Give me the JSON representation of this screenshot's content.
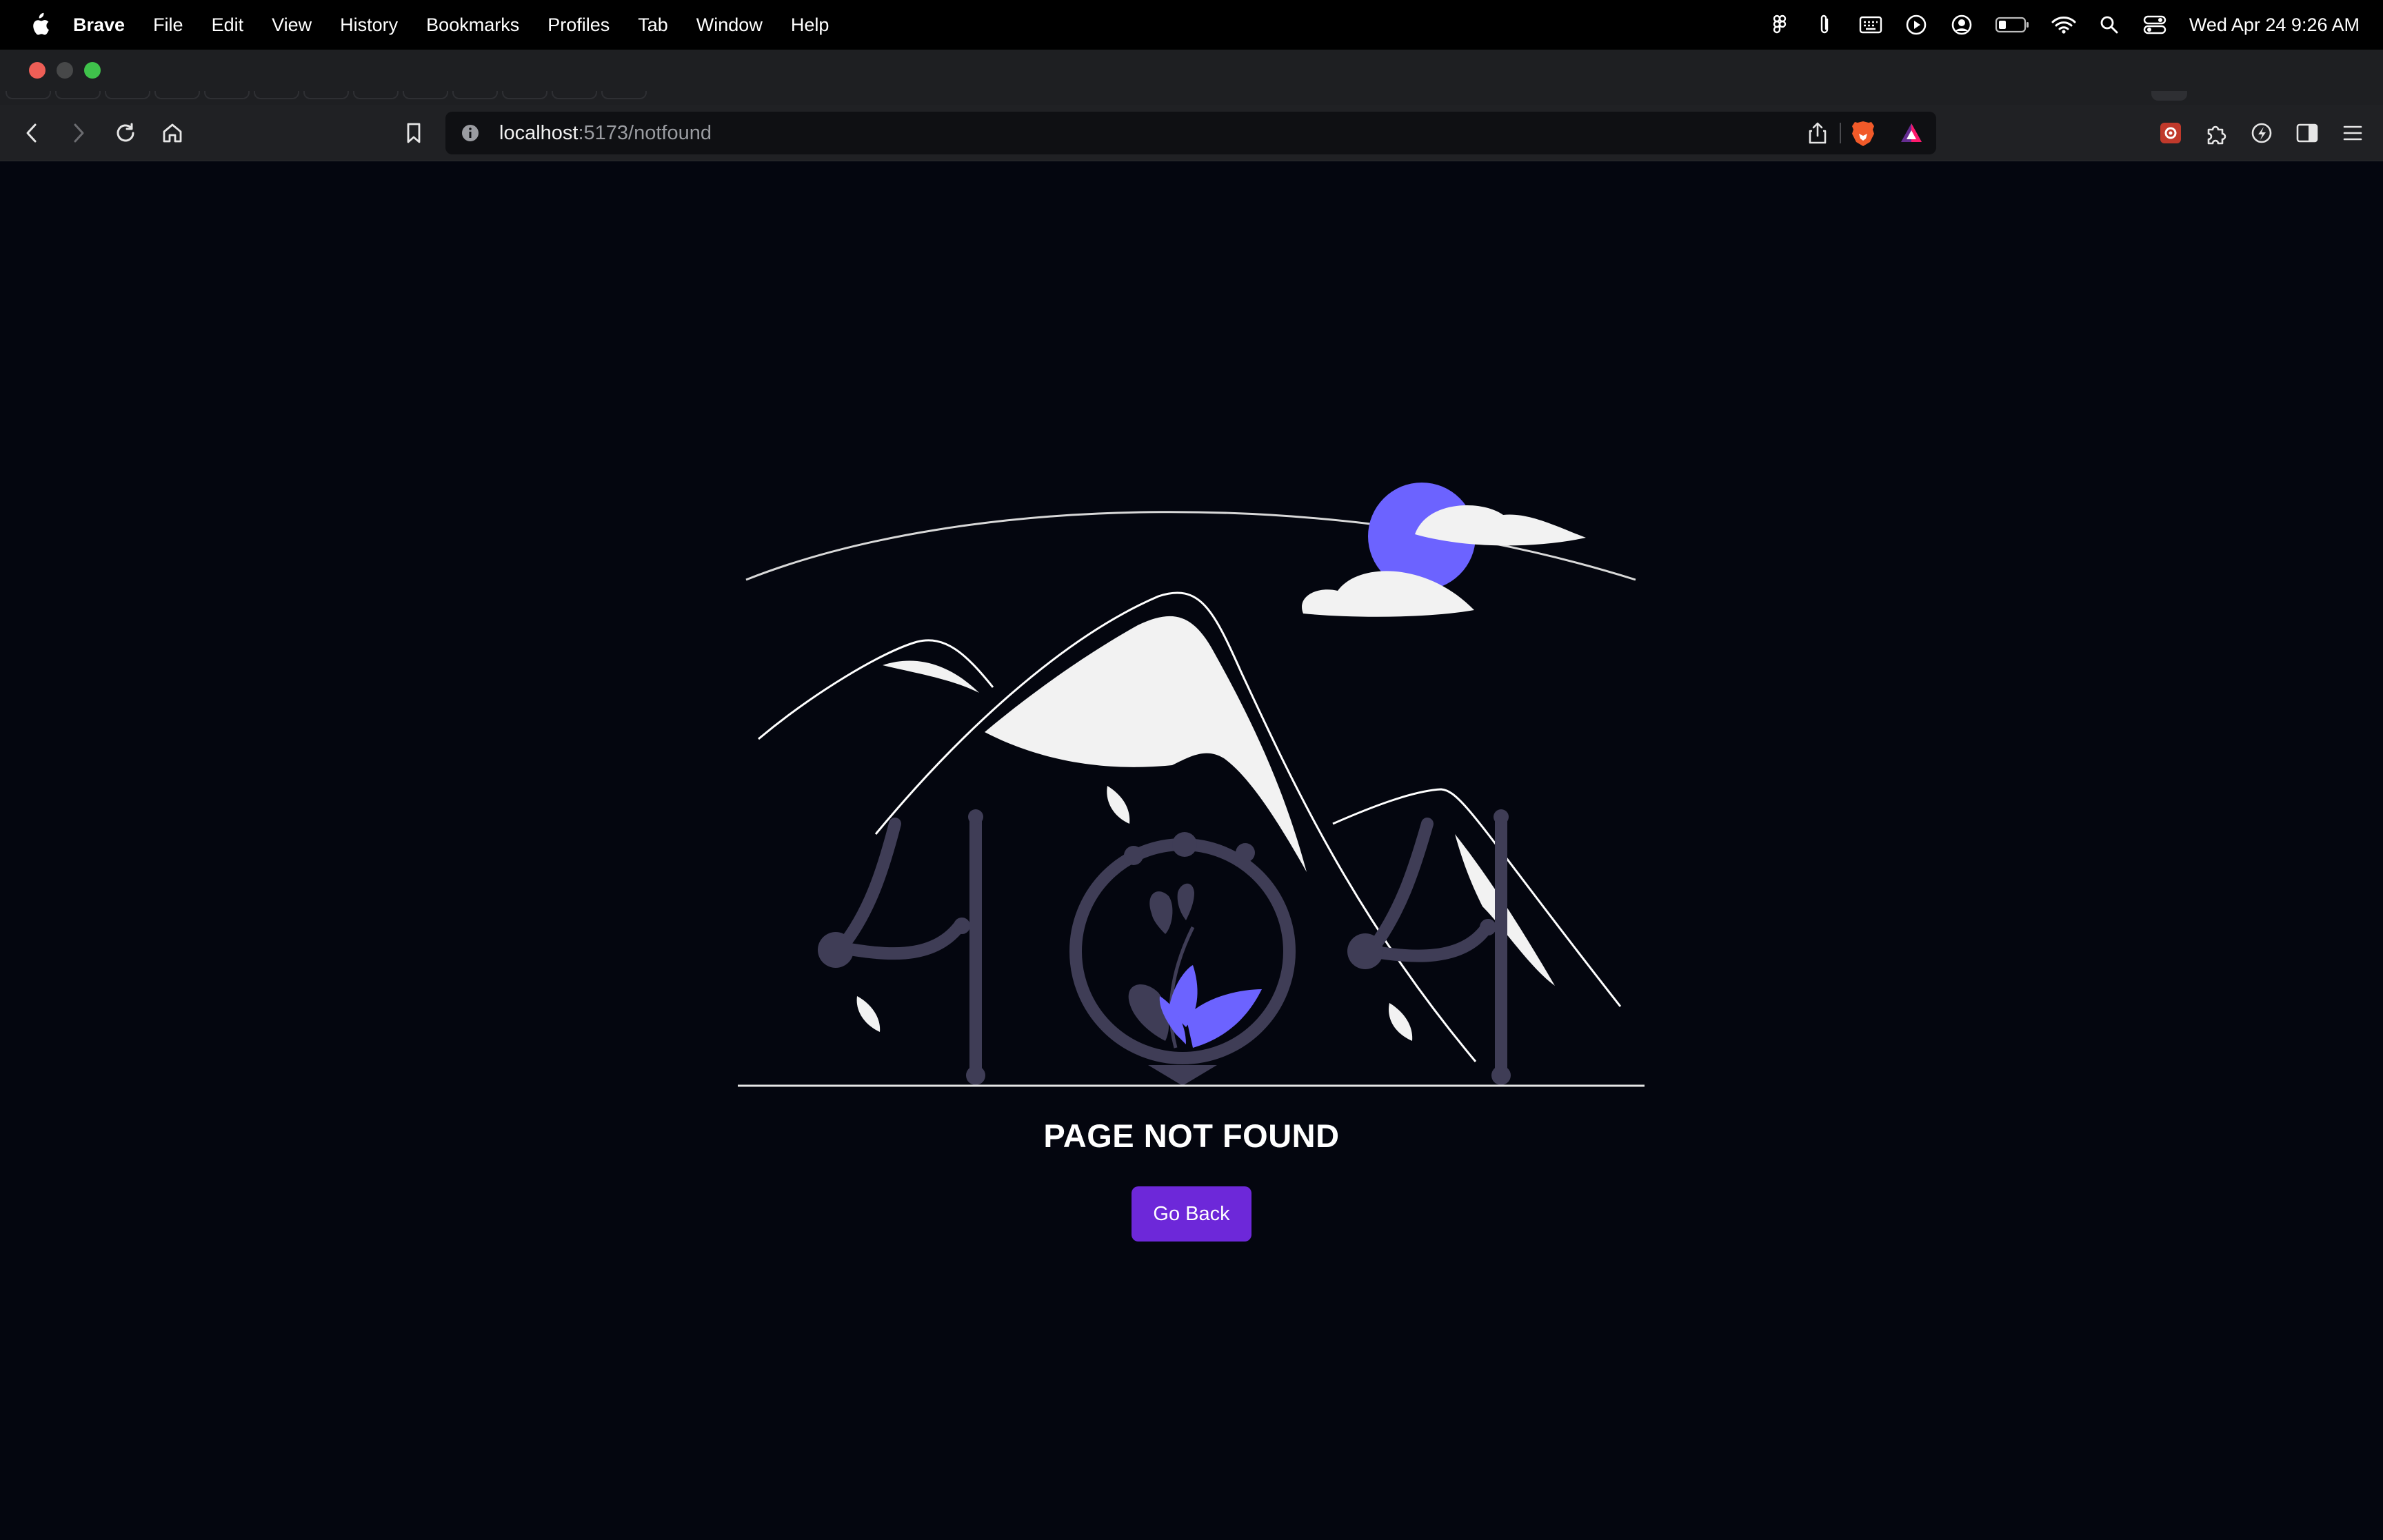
{
  "menubar": {
    "app_name": "Brave",
    "items": [
      "File",
      "Edit",
      "View",
      "History",
      "Bookmarks",
      "Profiles",
      "Tab",
      "Window",
      "Help"
    ],
    "clock": "Wed Apr 24  9:26 AM",
    "status_icons": [
      "figma-icon",
      "paperclip-icon",
      "keyboard-icon",
      "play-icon",
      "user-circle-icon",
      "battery-icon",
      "wifi-icon",
      "spotlight-search-icon",
      "control-center-icon"
    ]
  },
  "browser": {
    "url_host": "localhost",
    "url_path": ":5173/notfound"
  },
  "page": {
    "title": "PAGE NOT FOUND",
    "button_label": "Go Back",
    "colors": {
      "background": "#04060f",
      "accent": "#6c63ff",
      "button": "#6d28d9",
      "illustration_dark": "#3f3d56",
      "snow": "#f2f2f2"
    }
  }
}
